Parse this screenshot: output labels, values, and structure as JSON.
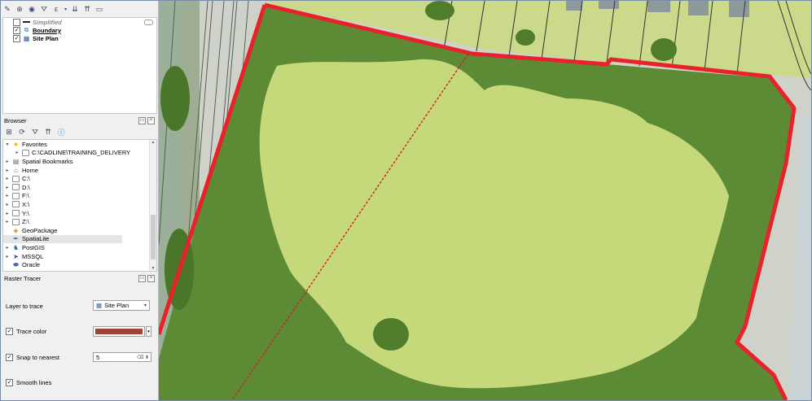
{
  "layers_panel": {
    "items": [
      {
        "label": "Simplified",
        "checked": false
      },
      {
        "label": "Boundary",
        "checked": true
      },
      {
        "label": "Site Plan",
        "checked": true
      }
    ]
  },
  "browser_panel": {
    "title": "Browser",
    "items": [
      {
        "label": "Favorites"
      },
      {
        "label": "C:\\CADLINE\\TRAINING_DELIVERY"
      },
      {
        "label": "Spatial Bookmarks"
      },
      {
        "label": "Home"
      },
      {
        "label": "C:\\"
      },
      {
        "label": "D:\\"
      },
      {
        "label": "F:\\"
      },
      {
        "label": "X:\\"
      },
      {
        "label": "Y:\\"
      },
      {
        "label": "Z:\\"
      },
      {
        "label": "GeoPackage"
      },
      {
        "label": "SpatiaLite"
      },
      {
        "label": "PostGIS"
      },
      {
        "label": "MSSQL"
      },
      {
        "label": "Oracle"
      }
    ]
  },
  "raster_tracer": {
    "title": "Raster Tracer",
    "layer_label": "Layer to trace",
    "layer_value": "Site Plan",
    "trace_color_label": "Trace color",
    "trace_color": "#9e4535",
    "snap_label": "Snap to nearest",
    "snap_value": "5",
    "smooth_label": "Smooth lines"
  },
  "colors": {
    "boundary": "#e8222a",
    "trace_line": "#d42020",
    "grass": "#c6d97a",
    "trees": "#5d8a35"
  }
}
